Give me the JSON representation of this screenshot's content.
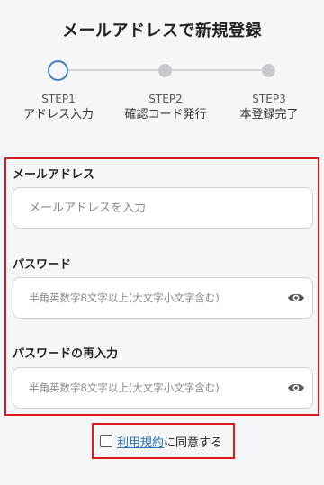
{
  "page": {
    "title": "メールアドレスで新規登録"
  },
  "stepper": {
    "steps": [
      {
        "num": "STEP1",
        "name": "アドレス入力",
        "state": "active"
      },
      {
        "num": "STEP2",
        "name": "確認コード発行",
        "state": "inactive"
      },
      {
        "num": "STEP3",
        "name": "本登録完了",
        "state": "inactive"
      }
    ]
  },
  "form": {
    "email": {
      "label": "メールアドレス",
      "placeholder": "メールアドレスを入力",
      "value": ""
    },
    "password": {
      "label": "パスワード",
      "placeholder": "半角英数字8文字以上(大文字小文字含む)",
      "value": ""
    },
    "password_confirm": {
      "label": "パスワードの再入力",
      "placeholder": "半角英数字8文字以上(大文字小文字含む)",
      "value": ""
    }
  },
  "agree": {
    "link_text": "利用規約",
    "suffix": "に同意する",
    "checked": false
  },
  "colors": {
    "accent": "#3d7fc0",
    "highlight_border": "#e0191f",
    "link": "#2a72b5"
  },
  "icons": {
    "password_toggle": "eye-icon"
  }
}
